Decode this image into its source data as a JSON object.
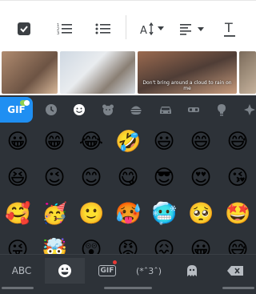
{
  "toolbar": {
    "buttons": [
      "checkbox-icon",
      "numbered-list-icon",
      "bulleted-list-icon",
      "text-size-icon",
      "align-icon",
      "text-format-icon"
    ]
  },
  "gifs": [
    {
      "caption": ""
    },
    {
      "caption": ""
    },
    {
      "caption": "Don't bring around a cloud to rain on me"
    },
    {
      "caption": ""
    }
  ],
  "keyboard": {
    "gif_badge": "GIF",
    "categories": [
      "recent-icon",
      "smiley-icon",
      "animal-icon",
      "food-icon",
      "travel-icon",
      "sports-icon",
      "objects-icon",
      "symbols-icon"
    ],
    "emoji_rows": [
      [
        "😀",
        "😁",
        "😂",
        "🤣",
        "😃",
        "😄",
        "😅"
      ],
      [
        "😆",
        "😉",
        "😊",
        "😋",
        "😎",
        "😍",
        "😘"
      ],
      [
        "🥰",
        "🥳",
        "🙂",
        "🥵",
        "🥶",
        "🥺",
        "🤩"
      ],
      [
        "😜",
        "🤯",
        "😲",
        "😡",
        "😖",
        "😀",
        "😅"
      ]
    ],
    "bottom": {
      "abc": "ABC",
      "gif": "GIF",
      "kaomoji": "(*ˆ3ˆ)"
    }
  }
}
